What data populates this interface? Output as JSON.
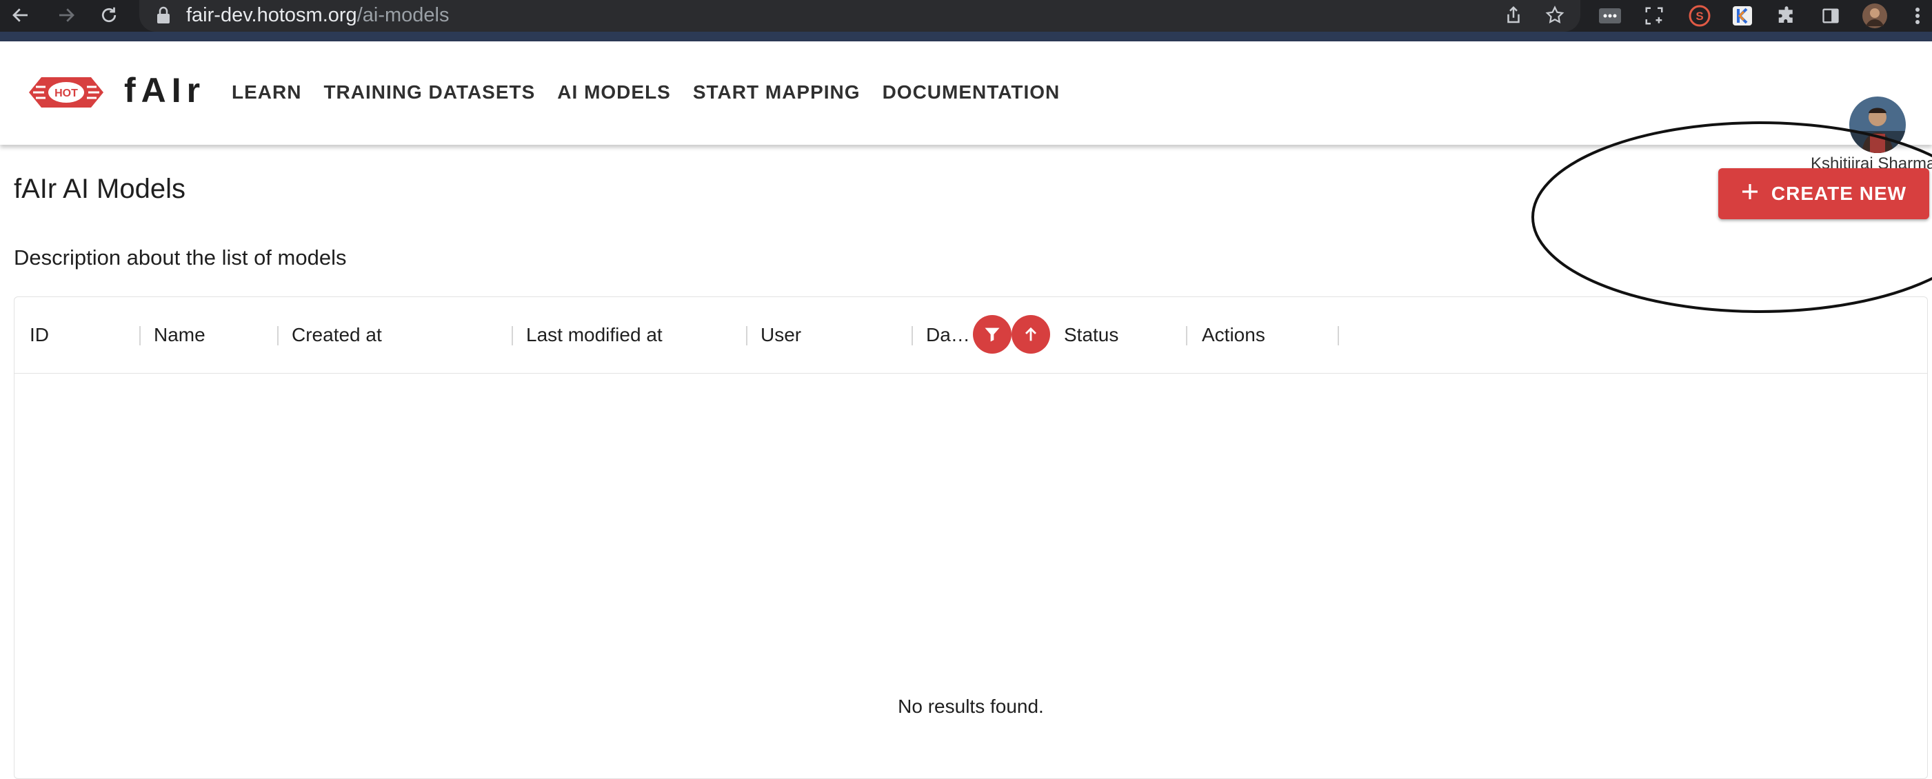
{
  "browser": {
    "url_host": "fair-dev.hotosm.org",
    "url_path": "/ai-models",
    "icons": [
      "back-icon",
      "forward-icon",
      "reload-icon",
      "lock-icon",
      "share-icon",
      "bookmark-star-icon",
      "ellipsis-extension-icon",
      "screenshot-extension-icon",
      "extension-s-icon",
      "extension-k-icon",
      "puzzle-extensions-icon",
      "side-panel-icon",
      "profile-avatar-icon",
      "browser-menu-icon"
    ]
  },
  "header": {
    "logo_text": "HOT",
    "brand": "fAIr",
    "nav": [
      "LEARN",
      "TRAINING DATASETS",
      "AI MODELS",
      "START MAPPING",
      "DOCUMENTATION"
    ],
    "user_name": "Kshitijraj Sharma"
  },
  "page": {
    "title": "fAIr AI Models",
    "description": "Description about the list of models",
    "create_button": "CREATE NEW"
  },
  "grid": {
    "columns": [
      "ID",
      "Name",
      "Created at",
      "Last modified at",
      "User",
      "Da…",
      "Status",
      "Actions"
    ],
    "header_icons": [
      "filter-icon",
      "sort-ascending-icon"
    ],
    "empty_message": "No results found."
  },
  "colors": {
    "accent": "#d73f3f",
    "browser_bar": "#202124",
    "text": "#1f1f1f"
  }
}
